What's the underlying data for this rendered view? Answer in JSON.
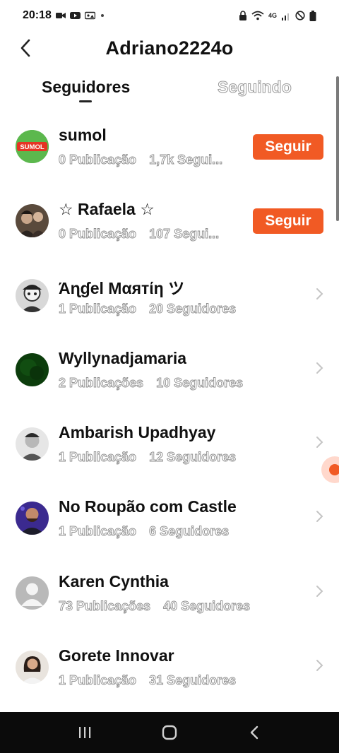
{
  "status_bar": {
    "time": "20:18",
    "left_icons": [
      "video-icon",
      "youtube-icon",
      "gallery-icon",
      "dot-icon"
    ],
    "right_icons": [
      "lock-icon",
      "wifi-icon",
      "network-4g-icon",
      "signal-icon",
      "dnd-icon",
      "battery-icon"
    ],
    "network_label": "4G"
  },
  "header": {
    "title": "Adriano2224o"
  },
  "tabs": [
    {
      "label": "Seguidores",
      "active": true
    },
    {
      "label": "Seguindo",
      "active": false
    }
  ],
  "follow_label": "Seguir",
  "accent_color": "#f15a24",
  "users": [
    {
      "name": "sumol",
      "posts": "0 Publicação",
      "followers": "1,7k Segui...",
      "action": "follow",
      "avatar": "sumol-logo"
    },
    {
      "name": "☆ Rafaela ☆",
      "posts": "0 Publicação",
      "followers": "107 Segui...",
      "action": "follow",
      "avatar": "photo"
    },
    {
      "name": "Άɳɠel Μαятίη ツ",
      "posts": "1 Publicação",
      "followers": "20 Seguidores",
      "action": "chevron",
      "avatar": "photo"
    },
    {
      "name": "Wyllynadjamaria",
      "posts": "2 Publicações",
      "followers": "10 Seguidores",
      "action": "chevron",
      "avatar": "dark-green"
    },
    {
      "name": "Ambarish Upadhyay",
      "posts": "1 Publicação",
      "followers": "12 Seguidores",
      "action": "chevron",
      "avatar": "photo"
    },
    {
      "name": "No Roupão com Castle",
      "posts": "1 Publicação",
      "followers": "6 Seguidores",
      "action": "chevron",
      "avatar": "photo"
    },
    {
      "name": "Karen Cynthia",
      "posts": "73 Publicações",
      "followers": "40 Seguidores",
      "action": "chevron",
      "avatar": "default-user"
    },
    {
      "name": "Gorete Innovar",
      "posts": "1 Publicação",
      "followers": "31 Seguidores",
      "action": "chevron",
      "avatar": "photo"
    }
  ],
  "sumol_logo_text": "SUMOL",
  "nav": [
    "recents-icon",
    "home-icon",
    "back-icon"
  ]
}
